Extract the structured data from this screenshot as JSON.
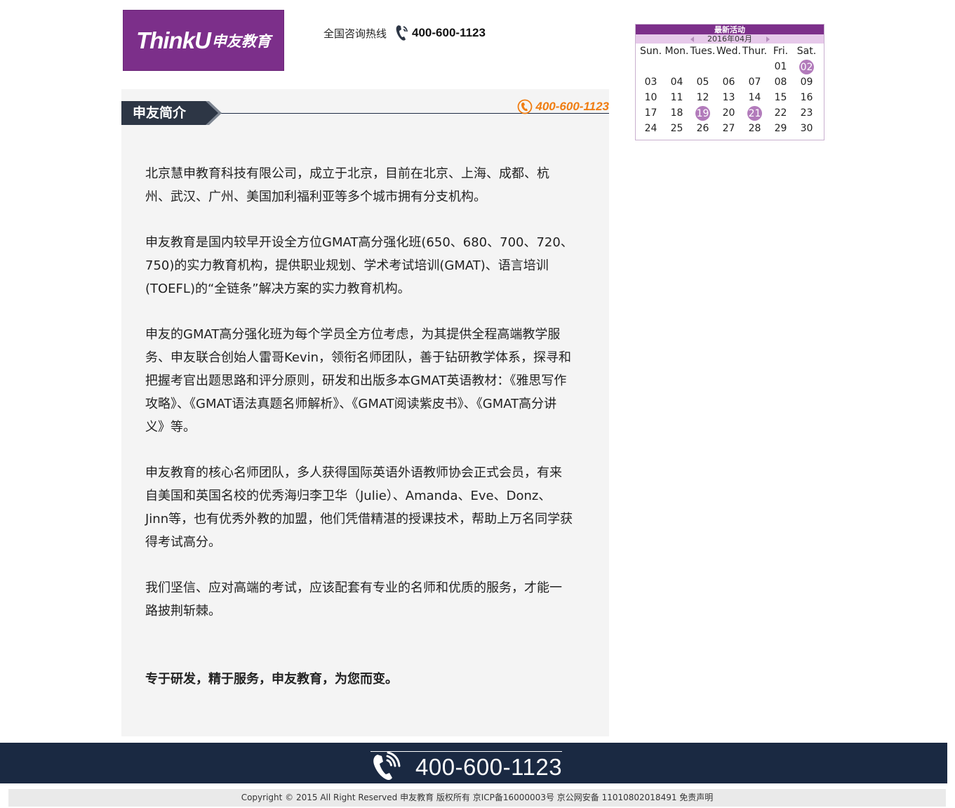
{
  "header": {
    "logo_en": "ThinkU",
    "logo_cn": "申友教育",
    "hotline_label": "全国咨询热线",
    "hotline_number": "400-600-1123"
  },
  "calendar": {
    "title": "最新活动",
    "month": "2016年04月",
    "weekdays": [
      "Sun.",
      "Mon.",
      "Tues.",
      "Wed.",
      "Thur.",
      "Fri.",
      "Sat."
    ],
    "weeks": [
      [
        "",
        "",
        "",
        "",
        "",
        "01",
        "02"
      ],
      [
        "03",
        "04",
        "05",
        "06",
        "07",
        "08",
        "09"
      ],
      [
        "10",
        "11",
        "12",
        "13",
        "14",
        "15",
        "16"
      ],
      [
        "17",
        "18",
        "19",
        "20",
        "21",
        "22",
        "23"
      ],
      [
        "24",
        "25",
        "26",
        "27",
        "28",
        "29",
        "30"
      ]
    ],
    "highlighted": [
      "02",
      "19",
      "21"
    ],
    "accent_color": "#7c2f8a",
    "highlight_color": "#b27bbb"
  },
  "section": {
    "title": "申友简介",
    "phone": "400-600-1123",
    "phone_color": "#f07d12",
    "paragraphs": [
      "北京慧申教育科技有限公司，成立于北京，目前在北京、上海、成都、杭州、武汉、广州、美国加利福利亚等多个城市拥有分支机构。",
      "申友教育是国内较早开设全方位GMAT高分强化班(650、680、700、720、750)的实力教育机构，提供职业规划、学术考试培训(GMAT)、语言培训(TOEFL)的“全链条”解决方案的实力教育机构。",
      "申友的GMAT高分强化班为每个学员全方位考虑，为其提供全程高端教学服务、申友联合创始人雷哥Kevin，领衔名师团队，善于钻研教学体系，探寻和把握考官出题思路和评分原则，研发和出版多本GMAT英语教材：《雅思写作攻略》、《GMAT语法真题名师解析》、《GMAT阅读紫皮书》、《GMAT高分讲义》等。",
      "申友教育的核心名师团队，多人获得国际英语外语教师协会正式会员，有来自美国和英国名校的优秀海归李卫华（Julie）、Amanda、Eve、Donz、Jinn等，也有优秀外教的加盟，他们凭借精湛的授课技术，帮助上万名同学获得考试高分。",
      "我们坚信、应对高端的考试，应该配套有专业的名师和优质的服务，才能一路披荆斩棘。"
    ],
    "slogan": "专于研发，精于服务，申友教育，为您而变。"
  },
  "footer": {
    "phone": "400-600-1123",
    "copyright": "Copyright © 2015 All Right Reserved 申友教育 版权所有 京ICP备16000003号 京公网安备 11010802018491 免责声明",
    "bar_color": "#1a2942"
  }
}
